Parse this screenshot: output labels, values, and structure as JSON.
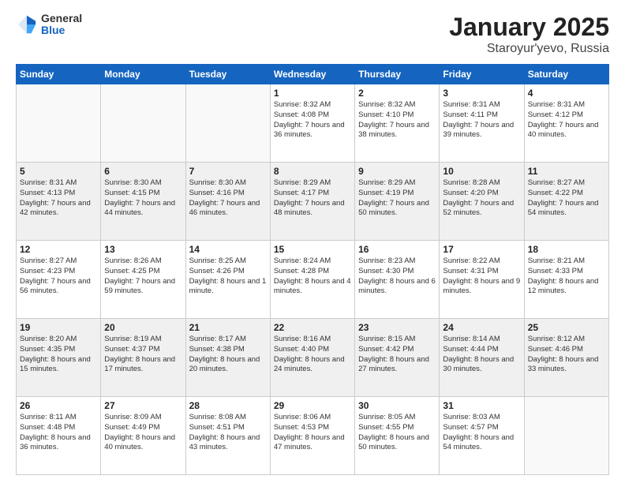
{
  "logo": {
    "general": "General",
    "blue": "Blue"
  },
  "title": "January 2025",
  "subtitle": "Staroyur'yevo, Russia",
  "weekdays": [
    "Sunday",
    "Monday",
    "Tuesday",
    "Wednesday",
    "Thursday",
    "Friday",
    "Saturday"
  ],
  "weeks": [
    [
      {
        "day": "",
        "detail": ""
      },
      {
        "day": "",
        "detail": ""
      },
      {
        "day": "",
        "detail": ""
      },
      {
        "day": "1",
        "detail": "Sunrise: 8:32 AM\nSunset: 4:08 PM\nDaylight: 7 hours\nand 36 minutes."
      },
      {
        "day": "2",
        "detail": "Sunrise: 8:32 AM\nSunset: 4:10 PM\nDaylight: 7 hours\nand 38 minutes."
      },
      {
        "day": "3",
        "detail": "Sunrise: 8:31 AM\nSunset: 4:11 PM\nDaylight: 7 hours\nand 39 minutes."
      },
      {
        "day": "4",
        "detail": "Sunrise: 8:31 AM\nSunset: 4:12 PM\nDaylight: 7 hours\nand 40 minutes."
      }
    ],
    [
      {
        "day": "5",
        "detail": "Sunrise: 8:31 AM\nSunset: 4:13 PM\nDaylight: 7 hours\nand 42 minutes."
      },
      {
        "day": "6",
        "detail": "Sunrise: 8:30 AM\nSunset: 4:15 PM\nDaylight: 7 hours\nand 44 minutes."
      },
      {
        "day": "7",
        "detail": "Sunrise: 8:30 AM\nSunset: 4:16 PM\nDaylight: 7 hours\nand 46 minutes."
      },
      {
        "day": "8",
        "detail": "Sunrise: 8:29 AM\nSunset: 4:17 PM\nDaylight: 7 hours\nand 48 minutes."
      },
      {
        "day": "9",
        "detail": "Sunrise: 8:29 AM\nSunset: 4:19 PM\nDaylight: 7 hours\nand 50 minutes."
      },
      {
        "day": "10",
        "detail": "Sunrise: 8:28 AM\nSunset: 4:20 PM\nDaylight: 7 hours\nand 52 minutes."
      },
      {
        "day": "11",
        "detail": "Sunrise: 8:27 AM\nSunset: 4:22 PM\nDaylight: 7 hours\nand 54 minutes."
      }
    ],
    [
      {
        "day": "12",
        "detail": "Sunrise: 8:27 AM\nSunset: 4:23 PM\nDaylight: 7 hours\nand 56 minutes."
      },
      {
        "day": "13",
        "detail": "Sunrise: 8:26 AM\nSunset: 4:25 PM\nDaylight: 7 hours\nand 59 minutes."
      },
      {
        "day": "14",
        "detail": "Sunrise: 8:25 AM\nSunset: 4:26 PM\nDaylight: 8 hours\nand 1 minute."
      },
      {
        "day": "15",
        "detail": "Sunrise: 8:24 AM\nSunset: 4:28 PM\nDaylight: 8 hours\nand 4 minutes."
      },
      {
        "day": "16",
        "detail": "Sunrise: 8:23 AM\nSunset: 4:30 PM\nDaylight: 8 hours\nand 6 minutes."
      },
      {
        "day": "17",
        "detail": "Sunrise: 8:22 AM\nSunset: 4:31 PM\nDaylight: 8 hours\nand 9 minutes."
      },
      {
        "day": "18",
        "detail": "Sunrise: 8:21 AM\nSunset: 4:33 PM\nDaylight: 8 hours\nand 12 minutes."
      }
    ],
    [
      {
        "day": "19",
        "detail": "Sunrise: 8:20 AM\nSunset: 4:35 PM\nDaylight: 8 hours\nand 15 minutes."
      },
      {
        "day": "20",
        "detail": "Sunrise: 8:19 AM\nSunset: 4:37 PM\nDaylight: 8 hours\nand 17 minutes."
      },
      {
        "day": "21",
        "detail": "Sunrise: 8:17 AM\nSunset: 4:38 PM\nDaylight: 8 hours\nand 20 minutes."
      },
      {
        "day": "22",
        "detail": "Sunrise: 8:16 AM\nSunset: 4:40 PM\nDaylight: 8 hours\nand 24 minutes."
      },
      {
        "day": "23",
        "detail": "Sunrise: 8:15 AM\nSunset: 4:42 PM\nDaylight: 8 hours\nand 27 minutes."
      },
      {
        "day": "24",
        "detail": "Sunrise: 8:14 AM\nSunset: 4:44 PM\nDaylight: 8 hours\nand 30 minutes."
      },
      {
        "day": "25",
        "detail": "Sunrise: 8:12 AM\nSunset: 4:46 PM\nDaylight: 8 hours\nand 33 minutes."
      }
    ],
    [
      {
        "day": "26",
        "detail": "Sunrise: 8:11 AM\nSunset: 4:48 PM\nDaylight: 8 hours\nand 36 minutes."
      },
      {
        "day": "27",
        "detail": "Sunrise: 8:09 AM\nSunset: 4:49 PM\nDaylight: 8 hours\nand 40 minutes."
      },
      {
        "day": "28",
        "detail": "Sunrise: 8:08 AM\nSunset: 4:51 PM\nDaylight: 8 hours\nand 43 minutes."
      },
      {
        "day": "29",
        "detail": "Sunrise: 8:06 AM\nSunset: 4:53 PM\nDaylight: 8 hours\nand 47 minutes."
      },
      {
        "day": "30",
        "detail": "Sunrise: 8:05 AM\nSunset: 4:55 PM\nDaylight: 8 hours\nand 50 minutes."
      },
      {
        "day": "31",
        "detail": "Sunrise: 8:03 AM\nSunset: 4:57 PM\nDaylight: 8 hours\nand 54 minutes."
      },
      {
        "day": "",
        "detail": ""
      }
    ]
  ]
}
